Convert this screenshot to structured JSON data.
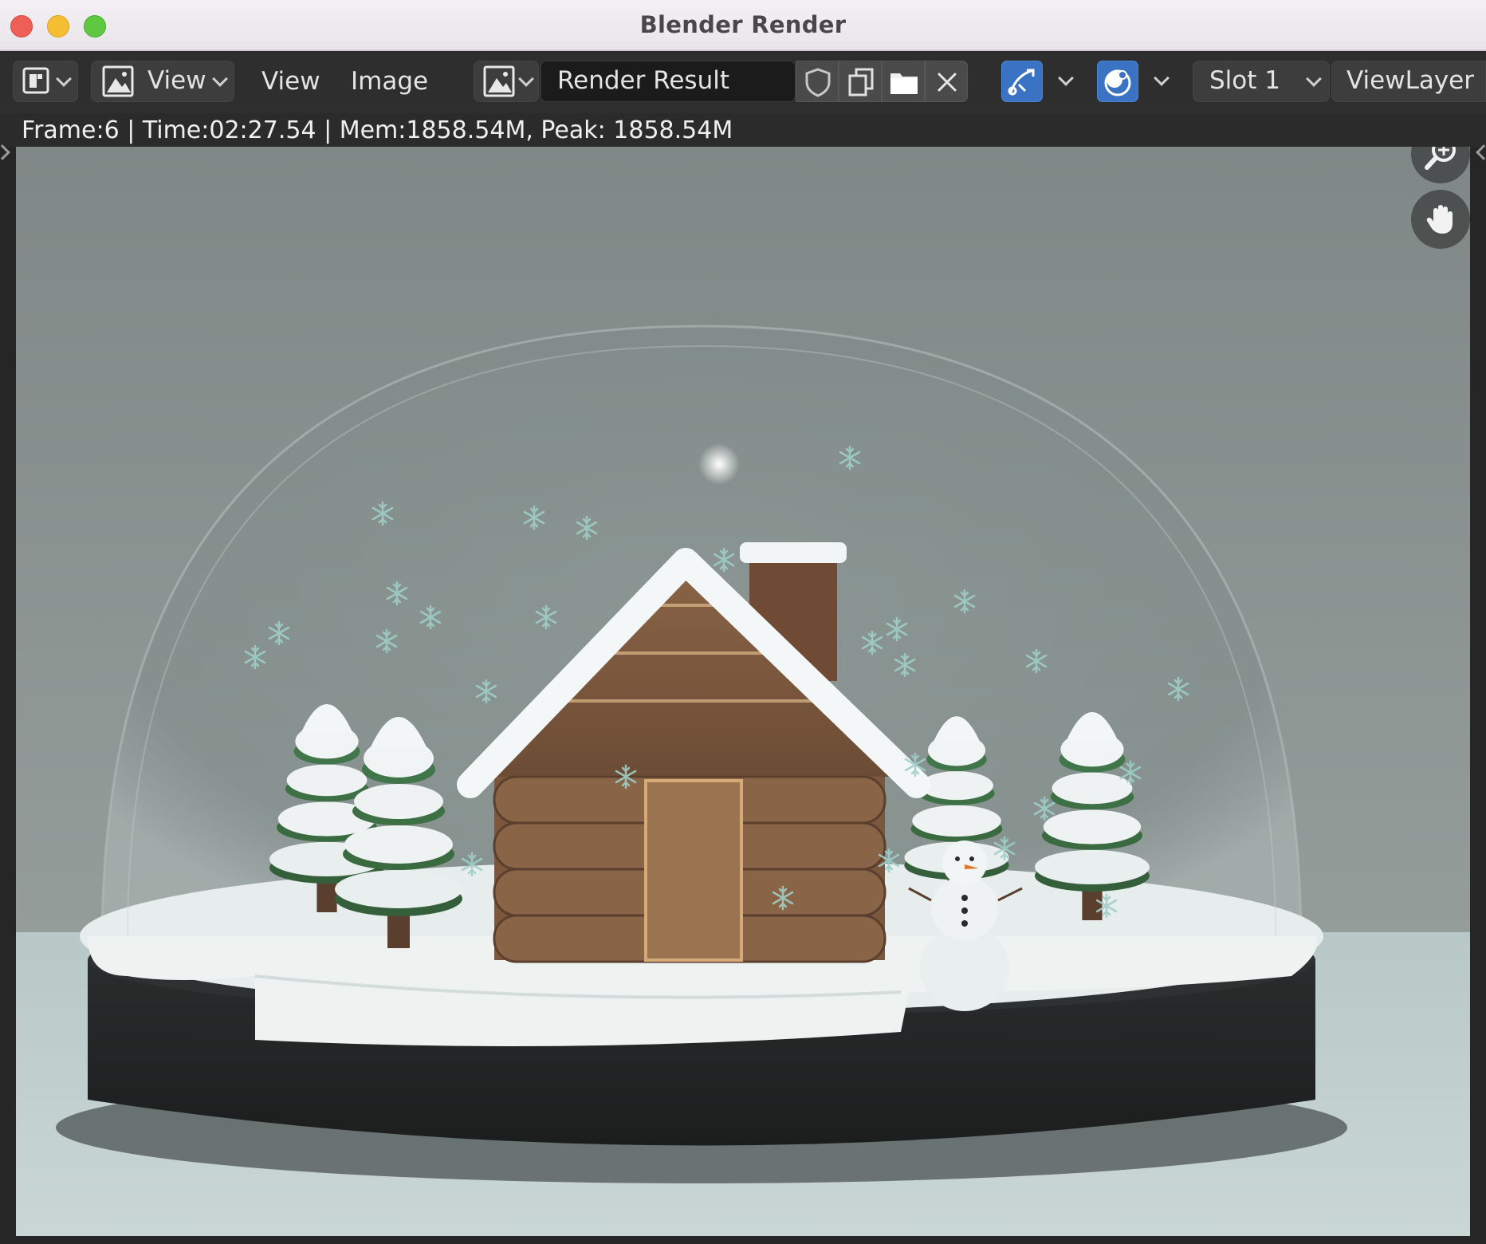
{
  "window": {
    "title": "Blender Render",
    "traffic_lights": {
      "close": "#ed5f57",
      "minimize": "#f5bd31",
      "maximize": "#5fc840"
    }
  },
  "header": {
    "editor_type_icon": "image-editor-icon",
    "mode_icon": "image-view-icon",
    "mode_label": "View",
    "menus": [
      "View",
      "Image"
    ],
    "image_browse_icon": "image-browse-icon",
    "image_name": "Render Result",
    "image_actions": [
      "fake-user-shield-icon",
      "duplicate-icon",
      "open-folder-icon",
      "close-icon"
    ],
    "gizmo_icon": "gizmo-icon",
    "overlay_icon": "overlay-icon",
    "slot_label": "Slot 1",
    "view_layer_label": "ViewLayer",
    "accent": "#3b73c4"
  },
  "info": {
    "text": "Frame:6 | Time:02:27.54 | Mem:1858.54M, Peak: 1858.54M"
  },
  "viewport": {
    "content": "render-result-image",
    "nav_icons": [
      "zoom-in-icon",
      "pan-hand-icon"
    ]
  }
}
